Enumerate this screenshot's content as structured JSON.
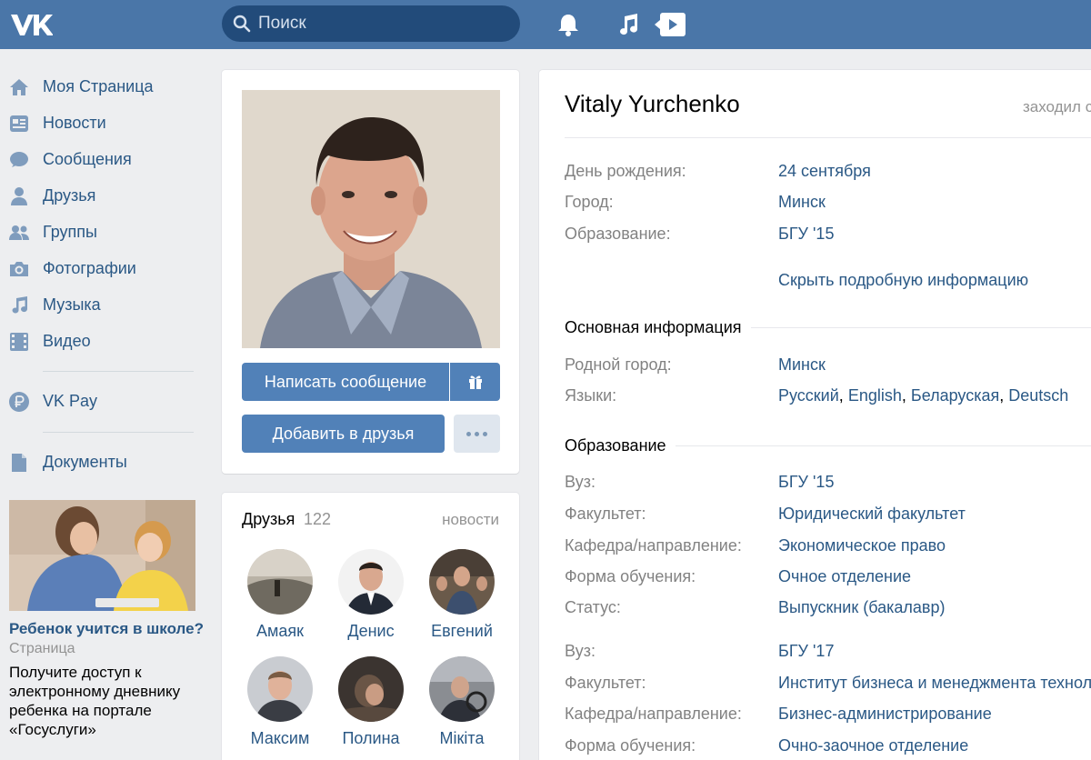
{
  "header": {
    "search_placeholder": "Поиск"
  },
  "sidebar": {
    "items": [
      {
        "label": "Моя Страница",
        "icon": "home-icon"
      },
      {
        "label": "Новости",
        "icon": "news-icon"
      },
      {
        "label": "Сообщения",
        "icon": "messages-icon"
      },
      {
        "label": "Друзья",
        "icon": "friend-icon"
      },
      {
        "label": "Группы",
        "icon": "groups-icon"
      },
      {
        "label": "Фотографии",
        "icon": "camera-icon"
      },
      {
        "label": "Музыка",
        "icon": "music-icon"
      },
      {
        "label": "Видео",
        "icon": "film-icon"
      },
      {
        "label": "VK Pay",
        "icon": "ruble-icon"
      },
      {
        "label": "Документы",
        "icon": "document-icon"
      }
    ]
  },
  "ad": {
    "title": "Ребенок учится в школе?",
    "type": "Страница",
    "text": "Получите доступ к электронному дневнику ребенка на портале «Госуслуги»"
  },
  "profile": {
    "name": "Vitaly Yurchenko",
    "online_status": "заходил сегодня",
    "message_button": "Написать сообщение",
    "add_friend_button": "Добавить в друзья",
    "short_info": [
      {
        "label": "День рождения:",
        "value": "24 сентября"
      },
      {
        "label": "Город:",
        "value": "Минск"
      },
      {
        "label": "Образование:",
        "value": "БГУ '15"
      }
    ],
    "hide_details_link": "Скрыть подробную информацию",
    "main_section_title": "Основная информация",
    "hometown_label": "Родной город:",
    "hometown_value": "Минск",
    "languages_label": "Языки:",
    "languages": [
      "Русский",
      "English",
      "Беларуская",
      "Deutsch"
    ],
    "education_section_title": "Образование",
    "education": [
      {
        "label": "Вуз:",
        "value": "БГУ '15"
      },
      {
        "label": "Факультет:",
        "value": "Юридический факультет"
      },
      {
        "label": "Кафедра/направление:",
        "value": "Экономическое право"
      },
      {
        "label": "Форма обучения:",
        "value": "Очное отделение"
      },
      {
        "label": "Статус:",
        "value": "Выпускник (бакалавр)"
      },
      {
        "label": "Вуз:",
        "value": "БГУ '17"
      },
      {
        "label": "Факультет:",
        "value": "Институт бизнеса и менеджмента технологий"
      },
      {
        "label": "Кафедра/направление:",
        "value": "Бизнес-администрирование"
      },
      {
        "label": "Форма обучения:",
        "value": "Очно-заочное отделение"
      }
    ]
  },
  "friends": {
    "title": "Друзья",
    "count": "122",
    "news_link": "новости",
    "list": [
      {
        "name": "Амаяк"
      },
      {
        "name": "Денис"
      },
      {
        "name": "Евгений"
      },
      {
        "name": "Максим"
      },
      {
        "name": "Полина"
      },
      {
        "name": "Мікіта"
      }
    ]
  },
  "colors": {
    "header": "#4a76a8",
    "link": "#2a5885",
    "button": "#5181b8",
    "background": "#edeef0"
  }
}
